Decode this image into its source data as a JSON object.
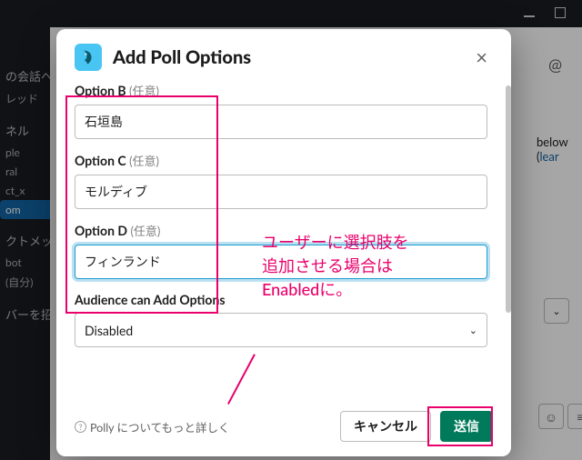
{
  "sidebar": {
    "heading": "の会話へ",
    "threads": "レッド",
    "section_channels": "ネル",
    "ch1": "ple",
    "ch2": "ral",
    "ch3": "ct_x",
    "ch_selected": "om",
    "section_dm": "クトメッ",
    "dm1": "bot",
    "dm2": "(自分)",
    "section_apps": "バーを招"
  },
  "right": {
    "at": "@",
    "below_text": "below (",
    "below_link": "lear"
  },
  "modal": {
    "title": "Add Poll Options",
    "optional": "(任意)",
    "optionB": {
      "label": "Option B",
      "value": "石垣島"
    },
    "optionC": {
      "label": "Option C",
      "value": "モルディブ"
    },
    "optionD": {
      "label": "Option D",
      "value": "フィンランド"
    },
    "audience_label": "Audience can Add Options",
    "audience_value": "Disabled",
    "more": "Polly についてもっと詳しく",
    "cancel": "キャンセル",
    "submit": "送信"
  },
  "annotation": {
    "line1": "ユーザーに選択肢を",
    "line2": "追加させる場合は",
    "line3": "Enabledに。"
  }
}
